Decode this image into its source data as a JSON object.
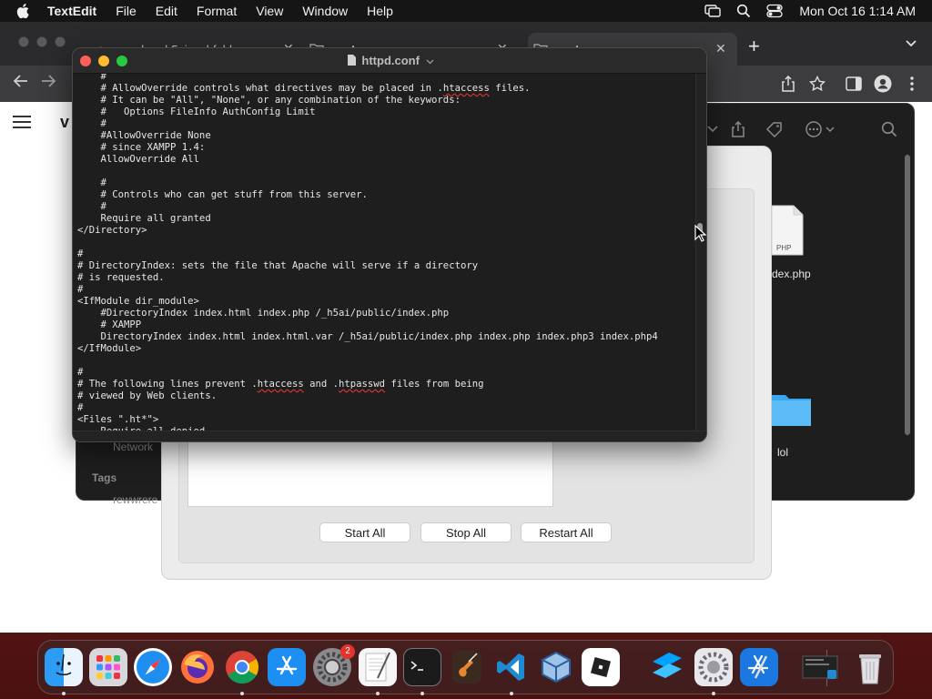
{
  "menubar": {
    "app_name": "TextEdit",
    "items": [
      "File",
      "Edit",
      "Format",
      "View",
      "Window",
      "Help"
    ],
    "clock": "Mon Oct 16  1:14 AM"
  },
  "browser": {
    "tabs": [
      {
        "title": "apache - h5ai: subfolders are"
      },
      {
        "title": "vm4"
      },
      {
        "title": "vm4"
      }
    ],
    "page_title": "v"
  },
  "finder": {
    "sidebar_fragment": "Network",
    "tags_label": "Tags",
    "tag_fragment": "rewwrere",
    "files": [
      {
        "name": "dex.php",
        "badge": "PHP"
      },
      {
        "name": "lol"
      }
    ]
  },
  "xampp": {
    "buttons": [
      "Start All",
      "Stop All",
      "Restart All"
    ]
  },
  "textedit": {
    "title": "httpd.conf",
    "lines": [
      "    #",
      "    # AllowOverride controls what directives may be placed in .htaccess files.",
      "    # It can be \"All\", \"None\", or any combination of the keywords:",
      "    #   Options FileInfo AuthConfig Limit",
      "    #",
      "    #AllowOverride None",
      "    # since XAMPP 1.4:",
      "    AllowOverride All",
      "",
      "    #",
      "    # Controls who can get stuff from this server.",
      "    #",
      "    Require all granted",
      "</Directory>",
      "",
      "#",
      "# DirectoryIndex: sets the file that Apache will serve if a directory",
      "# is requested.",
      "#",
      "<IfModule dir_module>",
      "    #DirectoryIndex index.html index.php /_h5ai/public/index.php",
      "    # XAMPP",
      "    DirectoryIndex index.html index.html.var /_h5ai/public/index.php index.php index.php3 index.php4",
      "</IfModule>",
      "",
      "#",
      "# The following lines prevent .htaccess and .htpasswd files from being",
      "# viewed by Web clients.",
      "#",
      "<Files \".ht*\">",
      "    Require all denied"
    ]
  },
  "dock": {
    "items": [
      "Finder",
      "Launchpad",
      "Safari",
      "Firefox",
      "Google Chrome",
      "App Store",
      "System Settings",
      "TextEdit",
      "Terminal",
      "GarageBand",
      "Visual Studio Code",
      "VirtualBox",
      "Roblox",
      "Roblox Studio",
      "XAMPP",
      "Xcode",
      "Window Preview",
      "Trash"
    ],
    "settings_badge": "2"
  }
}
